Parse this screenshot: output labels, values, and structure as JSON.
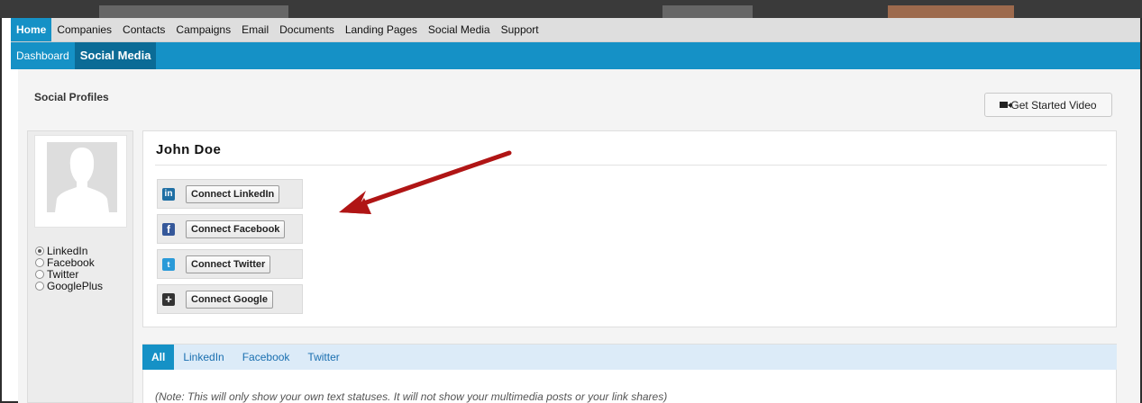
{
  "main_nav": {
    "items": [
      "Home",
      "Companies",
      "Contacts",
      "Campaigns",
      "Email",
      "Documents",
      "Landing Pages",
      "Social Media",
      "Support"
    ],
    "active": "Home"
  },
  "sub_nav": {
    "items": [
      "Dashboard",
      "Social Media"
    ],
    "active": "Social Media"
  },
  "page": {
    "section_title": "Social Profiles",
    "video_button": "Get Started Video"
  },
  "profile": {
    "name": "John Doe",
    "connect_buttons": [
      {
        "network": "LinkedIn",
        "label": "Connect LinkedIn",
        "icon": "linkedin-icon",
        "icon_glyph": "in",
        "color": "#1f6fa4"
      },
      {
        "network": "Facebook",
        "label": "Connect Facebook",
        "icon": "facebook-icon",
        "icon_glyph": "f",
        "color": "#35589a"
      },
      {
        "network": "Twitter",
        "label": "Connect Twitter",
        "icon": "twitter-icon",
        "icon_glyph": "t",
        "color": "#2a9ad8"
      },
      {
        "network": "Google",
        "label": "Connect Google",
        "icon": "googleplus-icon",
        "icon_glyph": "+",
        "color": "#333333"
      }
    ]
  },
  "network_radios": {
    "options": [
      "LinkedIn",
      "Facebook",
      "Twitter",
      "GooglePlus"
    ],
    "selected": "LinkedIn"
  },
  "feed": {
    "tabs": [
      "All",
      "LinkedIn",
      "Facebook",
      "Twitter"
    ],
    "active_tab": "All",
    "note": "(Note: This will only show your own text statuses. It will not show your multimedia posts or your link shares)"
  },
  "colors": {
    "accent": "#1591c6",
    "accent_dark": "#0b6b96",
    "annotation_arrow": "#b01515"
  }
}
